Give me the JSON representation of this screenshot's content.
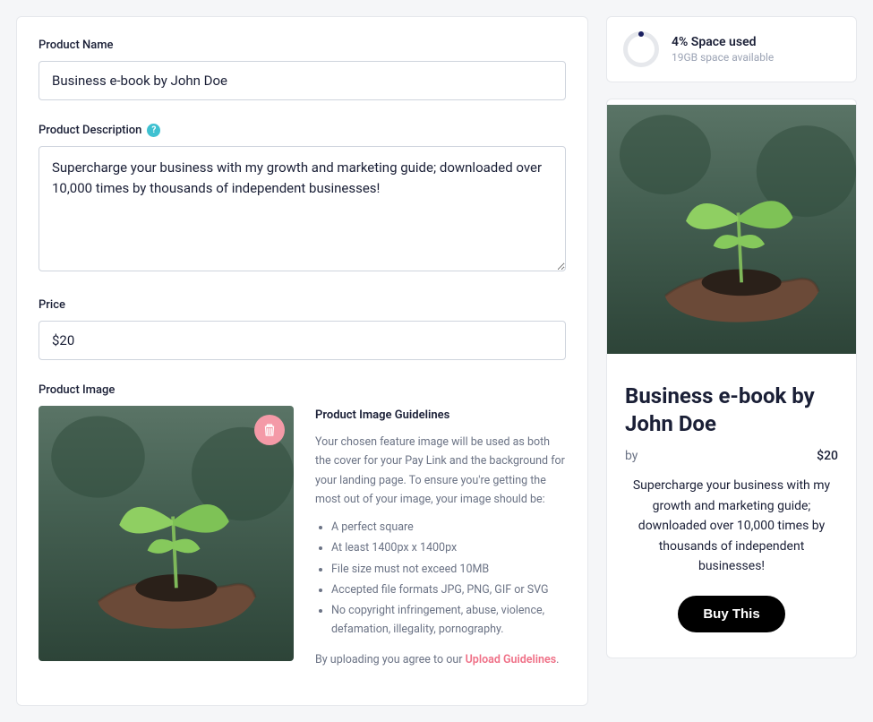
{
  "form": {
    "name_label": "Product Name",
    "name_value": "Business e-book by John Doe",
    "desc_label": "Product Description",
    "desc_value": "Supercharge your business with my growth and marketing guide; downloaded over 10,000 times by thousands of independent businesses!",
    "price_label": "Price",
    "price_value": "$20",
    "image_label": "Product Image"
  },
  "guidelines": {
    "heading": "Product Image Guidelines",
    "intro": "Your chosen feature image will be used as both the cover for your Pay Link and the background for your landing page. To ensure you're getting the most out of your image, your image should be:",
    "items": [
      "A perfect square",
      "At least 1400px x 1400px",
      "File size must not exceed 10MB",
      "Accepted file formats JPG, PNG, GIF or SVG",
      "No copyright infringement, abuse, violence, defamation, illegality, pornography."
    ],
    "agree_prefix": "By uploading you agree to our ",
    "agree_link": "Upload Guidelines"
  },
  "space": {
    "title": "4% Space used",
    "sub": "19GB space available"
  },
  "preview": {
    "title": "Business e-book by John Doe",
    "by_label": "by",
    "price": "$20",
    "desc": "Supercharge your business with my growth and marketing guide; downloaded over 10,000 times by thousands of independent businesses!",
    "buy_label": "Buy This"
  }
}
